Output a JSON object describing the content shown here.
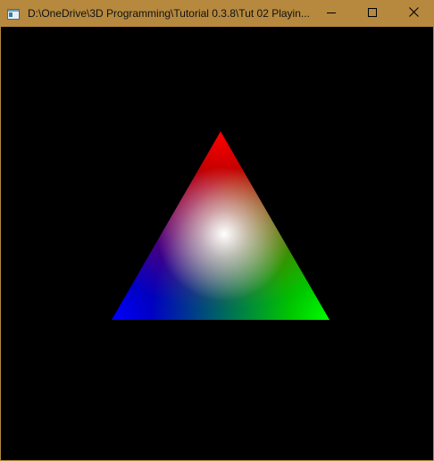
{
  "window": {
    "title": "D:\\OneDrive\\3D Programming\\Tutorial 0.3.8\\Tut 02 Playin...",
    "icon": "app-window-icon",
    "controls": {
      "minimize_icon": "minimize-icon",
      "maximize_icon": "maximize-icon",
      "close_icon": "close-icon"
    }
  },
  "scene": {
    "background": "#000000",
    "triangle": {
      "vertex_colors": [
        "#ff0000",
        "#00ff00",
        "#0000ff"
      ],
      "center_color": "#ffffff"
    }
  }
}
